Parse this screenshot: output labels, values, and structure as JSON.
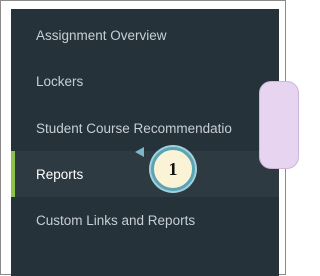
{
  "sidebar": {
    "items": [
      {
        "label": "Assignment Overview"
      },
      {
        "label": "Lockers"
      },
      {
        "label": "Student Course Recommendatio"
      },
      {
        "label": "Reports",
        "active": true
      },
      {
        "label": "Custom Links and Reports"
      }
    ]
  },
  "annotation": {
    "step_number": "1"
  },
  "colors": {
    "sidebar_bg": "#253239",
    "active_indicator": "#8bc34a",
    "callout_bg": "#e7d4f0",
    "badge_ring": "#5ba3b5"
  }
}
